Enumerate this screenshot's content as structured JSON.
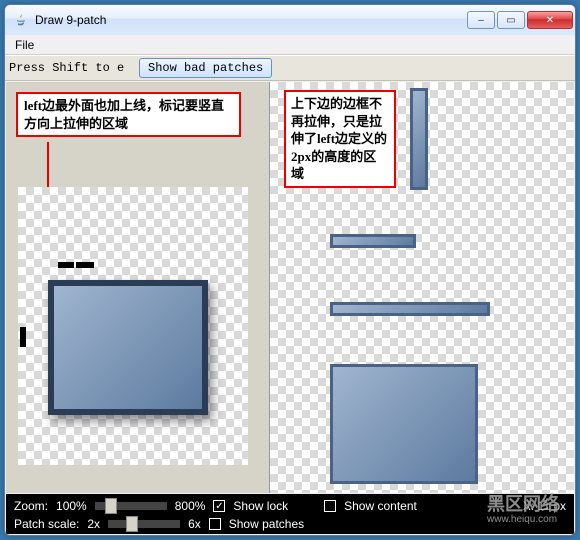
{
  "window": {
    "title": "Draw 9-patch"
  },
  "menu": {
    "file": "File"
  },
  "toolbar": {
    "hint": "Press Shift to e",
    "show_bad_patches": "Show bad patches"
  },
  "annotations": {
    "left": "left边最外面也加上线，标记要竖直方向上拉伸的区域",
    "right": "上下边的边框不再拉伸，只是拉伸了left边定义的2px的高度的区域"
  },
  "status": {
    "zoom_label": "Zoom:",
    "zoom_min": "100%",
    "zoom_max": "800%",
    "patch_scale_label": "Patch scale:",
    "patch_scale_min": "2x",
    "patch_scale_max": "6x",
    "show_lock": "Show lock",
    "show_content": "Show content",
    "show_patches": "Show patches",
    "coords": "X:  11 px",
    "lock_checked": true,
    "content_checked": false,
    "patches_checked": false
  },
  "watermark": {
    "brand": "黑区网络",
    "url": "www.heiqu.com"
  },
  "icons": {
    "minimize": "–",
    "maximize": "▭",
    "close": "✕"
  }
}
